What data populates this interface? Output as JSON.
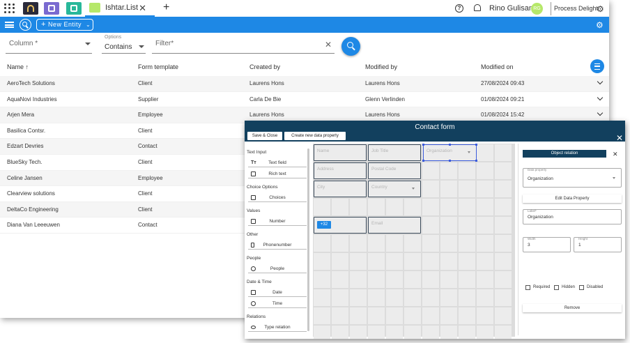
{
  "browser": {
    "active_tab": "Ishtar.List",
    "user_name": "Rino Gulisano",
    "user_initials": "RG",
    "brand_name": "Process Delight",
    "colors": {
      "toolbar": "#1e88e5",
      "form_header": "#12405e"
    }
  },
  "toolbar": {
    "new_entity_label": "New Entity"
  },
  "filters": {
    "column_placeholder": "Column *",
    "options_label": "Options",
    "options_value": "Contains",
    "filter_placeholder": "Filter*"
  },
  "table": {
    "columns": [
      "Name ↑",
      "Form template",
      "Created by",
      "Modified by",
      "Modified on"
    ],
    "rows": [
      [
        "AeroTech Solutions",
        "Client",
        "Laurens Hons",
        "Laurens Hons",
        "27/08/2024 09:43"
      ],
      [
        "AquaNovi Industries",
        "Supplier",
        "Carla De Bie",
        "Glenn Verlinden",
        "01/08/2024 09:21"
      ],
      [
        "Arjen Mera",
        "Employee",
        "Laurens Hons",
        "Laurens Hons",
        "01/08/2024 15:42"
      ],
      [
        "Basilica Contsr.",
        "Client",
        "",
        "",
        ""
      ],
      [
        "Edzart Devries",
        "Contact",
        "",
        "",
        ""
      ],
      [
        "BlueSky Tech.",
        "Client",
        "",
        "",
        ""
      ],
      [
        "Celine Jansen",
        "Employee",
        "",
        "",
        ""
      ],
      [
        "Clearview solutions",
        "Client",
        "",
        "",
        ""
      ],
      [
        "DeltaCo Engineering",
        "Client",
        "",
        "",
        ""
      ],
      [
        "Diana Van Leeeuwen",
        "Contact",
        "",
        "",
        ""
      ]
    ]
  },
  "form": {
    "title": "Contact form",
    "save_close": "Save & Close",
    "create_property": "Create new data property",
    "palette": {
      "sections": [
        "Text Input",
        "Choice Options",
        "Values",
        "Other",
        "People",
        "Date & Time",
        "Relations"
      ],
      "items": [
        "Text field",
        "Rich text",
        "Choices",
        "Number",
        "Phonenumber",
        "People",
        "Date",
        "Time",
        "Type relation"
      ]
    },
    "fields": {
      "name": "Name",
      "job_title": "Job Title",
      "organization": "Organization",
      "address": "Address",
      "postal_code": "Postal Code",
      "city": "City",
      "country": "Country",
      "phone_chip": "+32",
      "email": "Email"
    },
    "properties": {
      "header": "Object relation",
      "data_property_label": "Data property",
      "data_property_value": "Organization",
      "edit_button": "Edit Data Property",
      "label_label": "Label*",
      "label_value": "Organization",
      "width_label": "Width",
      "width_value": "3",
      "height_label": "Height",
      "height_value": "1",
      "required": "Required",
      "hidden": "Hidden",
      "disabled": "Disabled",
      "remove": "Remove"
    }
  }
}
